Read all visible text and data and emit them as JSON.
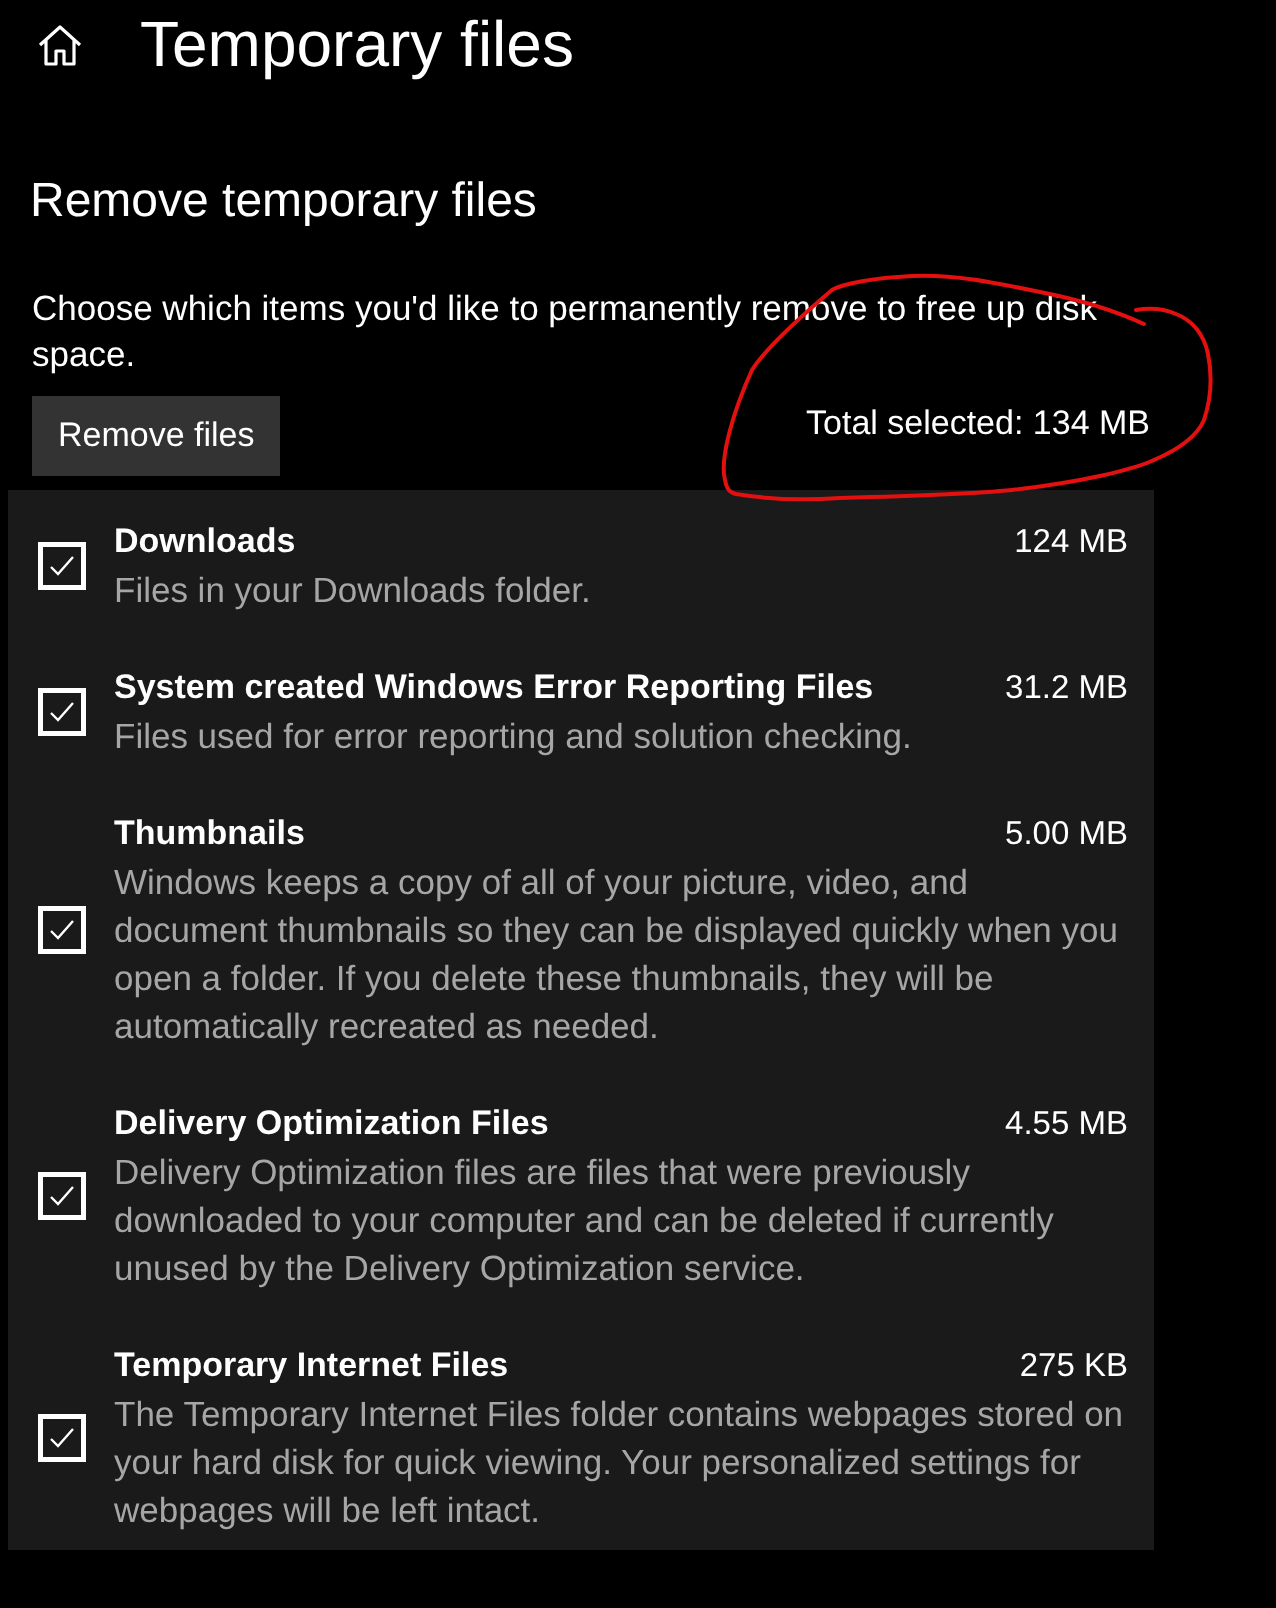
{
  "page": {
    "title": "Temporary files"
  },
  "section": {
    "heading": "Remove temporary files",
    "description": "Choose which items you'd like to permanently remove to free up disk space.",
    "button": "Remove files",
    "total_selected": {
      "text": "Total selected: 134 MB",
      "circled": true
    }
  },
  "items": [
    {
      "name": "Downloads",
      "size": "124 MB",
      "description": "Files in your Downloads folder.",
      "checked": true
    },
    {
      "name": "System created Windows Error Reporting Files",
      "size": "31.2 MB",
      "description": "Files used for error reporting and solution checking.",
      "checked": true
    },
    {
      "name": "Thumbnails",
      "size": "5.00 MB",
      "description": "Windows keeps a copy of all of your picture, video, and document thumbnails so they can be displayed quickly when you open a folder. If you delete these thumbnails, they will be automatically recreated as needed.",
      "checked": true
    },
    {
      "name": "Delivery Optimization Files",
      "size": "4.55 MB",
      "description": "Delivery Optimization files are files that were previously downloaded to your computer and can be deleted if currently unused by the Delivery Optimization service.",
      "checked": true
    },
    {
      "name": "Temporary Internet Files",
      "size": "275 KB",
      "description": "The Temporary Internet Files folder contains webpages stored on your hard disk for quick viewing. Your personalized settings for webpages will be left intact.",
      "checked": true
    }
  ]
}
